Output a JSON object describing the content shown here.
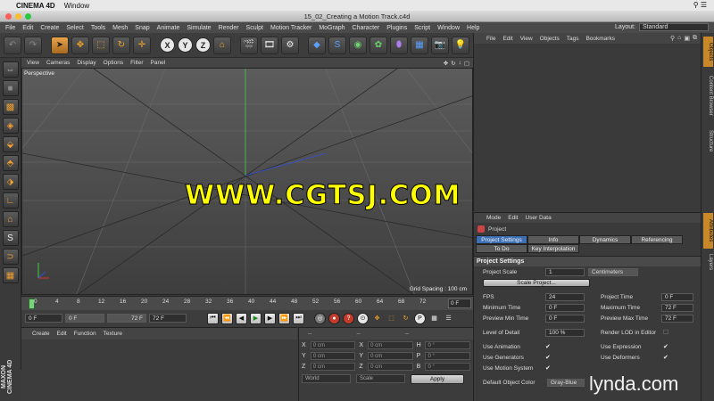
{
  "mac_menu": {
    "apple": "",
    "app": "CINEMA 4D",
    "window": "Window",
    "right_icons": "⚲ ☰"
  },
  "window": {
    "title": "15_02_Creating a Motion Track.c4d"
  },
  "app_menu": {
    "items": [
      "File",
      "Edit",
      "Create",
      "Select",
      "Tools",
      "Mesh",
      "Snap",
      "Animate",
      "Simulate",
      "Render",
      "Sculpt",
      "Motion Tracker",
      "MoGraph",
      "Character",
      "Plugins",
      "Script",
      "Window",
      "Help"
    ],
    "layout_label": "Layout:",
    "layout_value": "Standard"
  },
  "toolbar": {
    "axis_x": "X",
    "axis_y": "Y",
    "axis_z": "Z"
  },
  "viewport": {
    "menu": [
      "View",
      "Cameras",
      "Display",
      "Options",
      "Filter",
      "Panel"
    ],
    "label": "Perspective",
    "grid_spacing": "Grid Spacing : 100 cm",
    "watermark": "WWW.CGTSJ.COM"
  },
  "timeline": {
    "ticks": [
      "0",
      "4",
      "8",
      "12",
      "16",
      "20",
      "24",
      "28",
      "32",
      "36",
      "40",
      "44",
      "48",
      "52",
      "56",
      "60",
      "64",
      "68",
      "72"
    ],
    "current_frame": "0 F"
  },
  "transport": {
    "start": "0 F",
    "range_start": "0 F",
    "range_end": "72 F",
    "end": "72 F"
  },
  "material_manager": {
    "menu": [
      "Create",
      "Edit",
      "Function",
      "Texture"
    ]
  },
  "coordinates": {
    "headers": [
      "--",
      "--",
      "--"
    ],
    "rows": [
      {
        "a": "X",
        "av": "0 cm",
        "b": "X",
        "bv": "0 cm",
        "c": "H",
        "cv": "0 °"
      },
      {
        "a": "Y",
        "av": "0 cm",
        "b": "Y",
        "bv": "0 cm",
        "c": "P",
        "cv": "0 °"
      },
      {
        "a": "Z",
        "av": "0 cm",
        "b": "Z",
        "bv": "0 cm",
        "c": "B",
        "cv": "0 °"
      }
    ],
    "world": "World",
    "scale": "Scale",
    "apply": "Apply"
  },
  "object_manager": {
    "menu": [
      "File",
      "Edit",
      "View",
      "Objects",
      "Tags",
      "Bookmarks"
    ]
  },
  "attribute_manager": {
    "menu": [
      "Mode",
      "Edit",
      "User Data"
    ],
    "title": "Project",
    "tabs_row1": [
      "Project Settings",
      "Info",
      "Dynamics",
      "Referencing"
    ],
    "tabs_row2": [
      "To Do",
      "Key Interpolation"
    ],
    "section": "Project Settings",
    "project_scale_label": "Project Scale",
    "project_scale_value": "1",
    "project_scale_unit": "Centimeters",
    "scale_project_btn": "Scale Project...",
    "fps_label": "FPS",
    "fps_value": "24",
    "project_time_label": "Project Time",
    "project_time_value": "0 F",
    "min_time_label": "Minimum Time",
    "min_time_value": "0 F",
    "max_time_label": "Maximum Time",
    "max_time_value": "72 F",
    "prev_min_label": "Preview Min Time",
    "prev_min_value": "0 F",
    "prev_max_label": "Preview Max Time",
    "prev_max_value": "72 F",
    "lod_label": "Level of Detail",
    "lod_value": "100 %",
    "render_lod_label": "Render LOD in Editor",
    "use_animation": "Use Animation",
    "use_expression": "Use Expression",
    "use_generators": "Use Generators",
    "use_deformers": "Use Deformers",
    "use_motion_system": "Use Motion System",
    "default_color_label": "Default Object Color",
    "default_color_value": "Gray-Blue"
  },
  "side_tabs": [
    "Objects",
    "Content Browser",
    "Structure",
    "Attributes",
    "Layers"
  ],
  "branding": {
    "maxon": "MAXON CINEMA 4D",
    "lynda": "lynda.com"
  },
  "colors": {
    "accent": "#f5a623",
    "tab_active": "#3d6fb4",
    "watermark": "#ffff00"
  }
}
